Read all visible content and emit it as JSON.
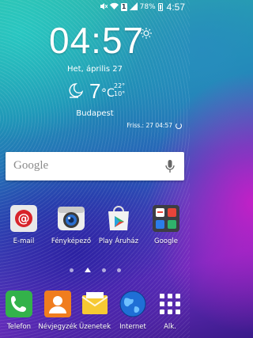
{
  "status_bar": {
    "battery_percent": "78%",
    "sim_label": "1",
    "time": "4:57",
    "icons": [
      "mute-icon",
      "wifi-icon",
      "sim-icon",
      "signal-icon",
      "battery-icon"
    ]
  },
  "clock_widget": {
    "time": "04:57",
    "date": "Het, április 27",
    "temperature": "7",
    "unit": "°C",
    "high": "22°",
    "low": "10°",
    "city": "Budapest",
    "refresh_text": "Friss.: 27 04:57",
    "weather_icon": "moon-cloud-icon",
    "sun_icon": "sun-icon"
  },
  "search": {
    "logo": "Google",
    "mic_icon": "mic-icon"
  },
  "home_apps": [
    {
      "label": "E-mail",
      "icon": "email-icon"
    },
    {
      "label": "Fényképező",
      "icon": "camera-icon"
    },
    {
      "label": "Play Áruház",
      "icon": "play-store-icon"
    },
    {
      "label": "Google",
      "icon": "google-folder-icon"
    }
  ],
  "page_indicator": {
    "pages": 4,
    "current": 1
  },
  "dock": [
    {
      "label": "Telefon",
      "icon": "phone-icon"
    },
    {
      "label": "Névjegyzék",
      "icon": "contacts-icon"
    },
    {
      "label": "Üzenetek",
      "icon": "messages-icon"
    },
    {
      "label": "Internet",
      "icon": "internet-icon"
    },
    {
      "label": "Alk.",
      "icon": "apps-grid-icon"
    }
  ]
}
